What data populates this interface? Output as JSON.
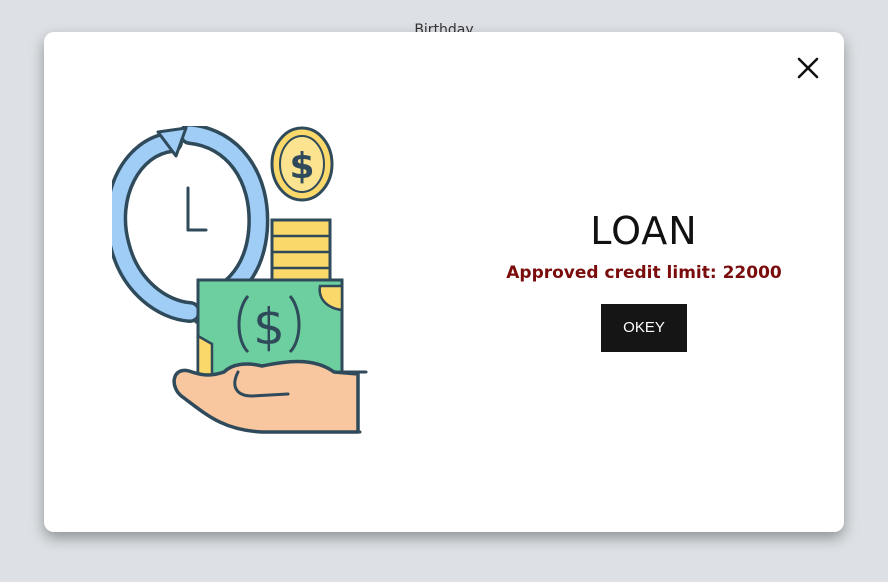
{
  "background": {
    "label": "Birthday"
  },
  "modal": {
    "title": "LOAN",
    "message": "Approved credit limit: 22000",
    "button_label": "OKEY",
    "close_icon": "close-icon",
    "illustration": "loan-money-hand-icon",
    "accent_color": "#7a0c0c"
  }
}
